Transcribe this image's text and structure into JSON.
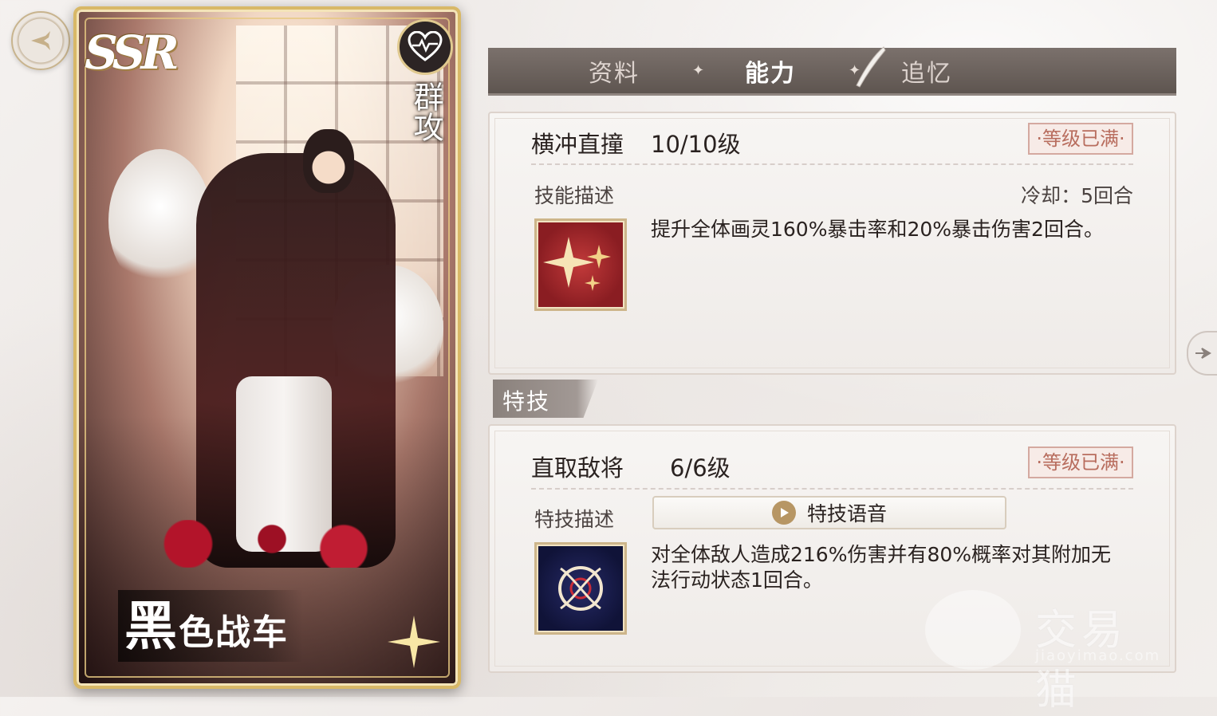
{
  "card": {
    "rarity": "SSR",
    "type": "群攻",
    "name_first": "黑",
    "name_rest": "色战车"
  },
  "tabs": [
    {
      "label": "资料",
      "active": false
    },
    {
      "label": "能力",
      "active": true
    },
    {
      "label": "追忆",
      "active": false
    }
  ],
  "skill": {
    "name": "横冲直撞",
    "level": "10/10级",
    "max_badge": "·等级已满·",
    "desc_label": "技能描述",
    "cooldown": "冷却：5回合",
    "description": "提升全体画灵160%暴击率和20%暴击伤害2回合。",
    "icon": "sparkle-burst-icon"
  },
  "special": {
    "section_label": "特技",
    "name": "直取敌将",
    "level": "6/6级",
    "max_badge": "·等级已满·",
    "desc_label": "特技描述",
    "voice_label": "特技语音",
    "description": "对全体敌人造成216%伤害并有80%概率对其附加无法行动状态1回合。",
    "icon": "ornate-emblem-icon"
  },
  "watermark": {
    "title": "交易猫",
    "url": "jiaoyimao.com"
  },
  "colors": {
    "tab_bar": "#6a605b",
    "badge_text": "#b86d5e",
    "card_frame": "#d8b867"
  }
}
